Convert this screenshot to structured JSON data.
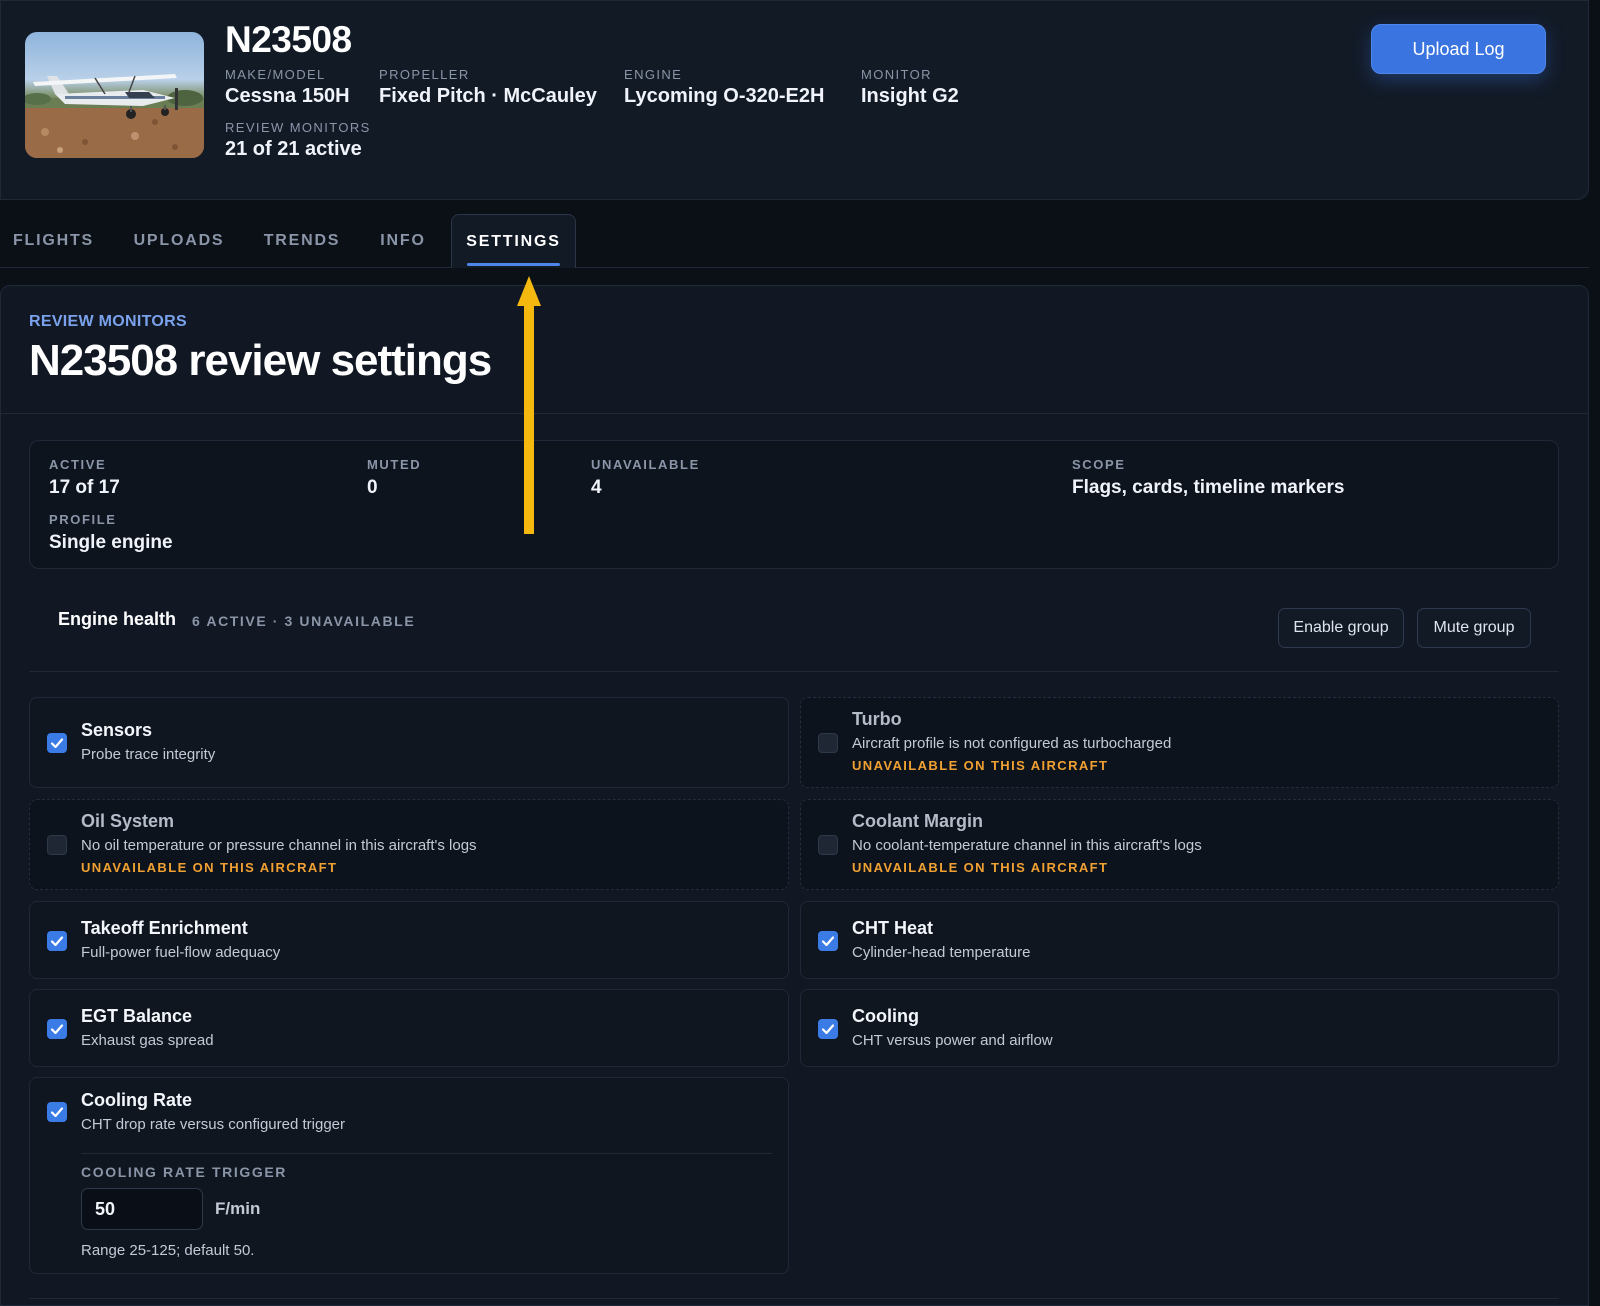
{
  "aircraft": {
    "tail_number": "N23508",
    "fields": [
      {
        "label": "MAKE/MODEL",
        "value": "Cessna 150H"
      },
      {
        "label": "PROPELLER",
        "value": "Fixed Pitch · McCauley"
      },
      {
        "label": "ENGINE",
        "value": "Lycoming O-320-E2H"
      },
      {
        "label": "MONITOR",
        "value": "Insight G2"
      },
      {
        "label": "REVIEW MONITORS",
        "value": "21 of 21 active"
      }
    ]
  },
  "actions": {
    "upload_label": "Upload Log"
  },
  "tabs": [
    {
      "label": "FLIGHTS",
      "active": false
    },
    {
      "label": "UPLOADS",
      "active": false
    },
    {
      "label": "TRENDS",
      "active": false
    },
    {
      "label": "INFO",
      "active": false
    },
    {
      "label": "SETTINGS",
      "active": true
    }
  ],
  "page": {
    "eyebrow": "REVIEW MONITORS",
    "title": "N23508 review settings"
  },
  "summary": [
    {
      "label": "ACTIVE",
      "value": "17 of 17"
    },
    {
      "label": "MUTED",
      "value": "0"
    },
    {
      "label": "UNAVAILABLE",
      "value": "4"
    },
    {
      "label": "SCOPE",
      "value": "Flags, cards, timeline markers"
    },
    {
      "label": "PROFILE",
      "value": "Single engine"
    }
  ],
  "group": {
    "name": "Engine health",
    "counts": "6 ACTIVE · 3 UNAVAILABLE",
    "enable_label": "Enable group",
    "mute_label": "Mute group"
  },
  "monitors": [
    {
      "title": "Sensors",
      "desc": "Probe trace integrity",
      "checked": true
    },
    {
      "title": "Turbo",
      "desc": "Aircraft profile is not configured as turbocharged",
      "warning": "UNAVAILABLE ON THIS AIRCRAFT",
      "checked": false
    },
    {
      "title": "Oil System",
      "desc": "No oil temperature or pressure channel in this aircraft's logs",
      "warning": "UNAVAILABLE ON THIS AIRCRAFT",
      "checked": false
    },
    {
      "title": "Coolant Margin",
      "desc": "No coolant-temperature channel in this aircraft's logs",
      "warning": "UNAVAILABLE ON THIS AIRCRAFT",
      "checked": false
    },
    {
      "title": "Takeoff Enrichment",
      "desc": "Full-power fuel-flow adequacy",
      "checked": true
    },
    {
      "title": "CHT Heat",
      "desc": "Cylinder-head temperature",
      "checked": true
    },
    {
      "title": "EGT Balance",
      "desc": "Exhaust gas spread",
      "checked": true
    },
    {
      "title": "Cooling",
      "desc": "CHT versus power and airflow",
      "checked": true
    },
    {
      "title": "Cooling Rate",
      "desc": "CHT drop rate versus configured trigger",
      "checked": true
    }
  ],
  "cooling_rate_trigger": {
    "label": "COOLING RATE TRIGGER",
    "value": "50",
    "unit": "F/min",
    "hint": "Range 25-125; default 50."
  },
  "colors": {
    "accent": "#3a74e0",
    "warning": "#f0a132",
    "annotation_arrow": "#f5b80e"
  }
}
